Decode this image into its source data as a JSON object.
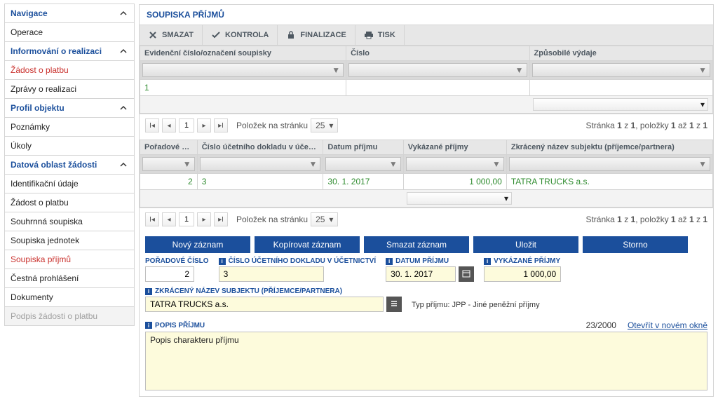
{
  "sidebar": {
    "sections": [
      {
        "label": "Navigace",
        "collapsible": true
      },
      null,
      {
        "label": "Informování o realizaci",
        "collapsible": true
      },
      null,
      null,
      {
        "label": "Profil objektu",
        "collapsible": true
      },
      null,
      null,
      {
        "label": "Datová oblast žádosti",
        "collapsible": true
      }
    ],
    "items": {
      "operace": "Operace",
      "zadost_o_platbu": "Žádost o platbu",
      "zpravy_o_realizaci": "Zprávy o realizaci",
      "poznamky": "Poznámky",
      "ukoly": "Úkoly",
      "identifikacni_udaje": "Identifikační údaje",
      "zadost_o_platbu_2": "Žádost o platbu",
      "souhrnna_soupiska": "Souhrnná soupiska",
      "soupiska_jednotek": "Soupiska jednotek",
      "soupiska_prijmu": "Soupiska příjmů",
      "cestna_prohlaseni": "Čestná prohlášení",
      "dokumenty": "Dokumenty",
      "podpis_zadosti_o_platbu": "Podpis žádosti o platbu"
    }
  },
  "panel_title": "SOUPISKA PŘÍJMŮ",
  "toolbar": {
    "smazat": "SMAZAT",
    "kontrola": "KONTROLA",
    "finalizace": "FINALIZACE",
    "tisk": "TISK"
  },
  "grid1": {
    "headers": {
      "c0": "Evidenční číslo/označení soupisky",
      "c1": "Číslo",
      "c2": "Způsobilé výdaje"
    },
    "row": {
      "c0": "1",
      "c1": "",
      "c2": ""
    }
  },
  "pager": {
    "items_label": "Položek na stránku",
    "page_val": "1",
    "size_val": "25",
    "info_prefix": "Stránka ",
    "info_mid1": "1",
    "info_z": " z ",
    "info_mid2": "1",
    "info_items": ", položky ",
    "info_r1": "1",
    "info_az": " až ",
    "info_r2": "1",
    "info_z2": " z ",
    "info_tot": "1"
  },
  "grid2": {
    "headers": {
      "c0": "Pořadové číslo",
      "c1": "Číslo účetního dokladu v účetnictví",
      "c2": "Datum příjmu",
      "c3": "Vykázané příjmy",
      "c4": "Zkrácený název subjektu (příjemce/partnera)"
    },
    "row": {
      "c0": "2",
      "c1": "3",
      "c2": "30. 1. 2017",
      "c3": "1 000,00",
      "c4": "TATRA TRUCKS a.s."
    }
  },
  "buttons": {
    "novy": "Nový záznam",
    "kopirovat": "Kopírovat záznam",
    "smazat": "Smazat záznam",
    "ulozit": "Uložit",
    "storno": "Storno"
  },
  "form": {
    "poradove_label": "POŘADOVÉ ČÍSLO",
    "poradove_value": "2",
    "cislo_dokladu_label": "ČÍSLO ÚČETNÍHO DOKLADU V ÚČETNICTVÍ",
    "cislo_dokladu_value": "3",
    "datum_label": "DATUM PŘÍJMU",
    "datum_value": "30. 1. 2017",
    "vykazane_label": "VYKÁZANÉ PŘÍJMY",
    "vykazane_value": "1 000,00",
    "subjekt_label": "ZKRÁCENÝ NÁZEV SUBJEKTU (PŘÍJEMCE/PARTNERA)",
    "subjekt_value": "TATRA TRUCKS a.s.",
    "typ_prijmu": "Typ příjmu: JPP - Jiné peněžní příjmy",
    "popis_label": "POPIS PŘÍJMU",
    "popis_count": "23/2000",
    "popis_link": "Otevřít v novém okně",
    "popis_value": "Popis charakteru příjmu"
  }
}
